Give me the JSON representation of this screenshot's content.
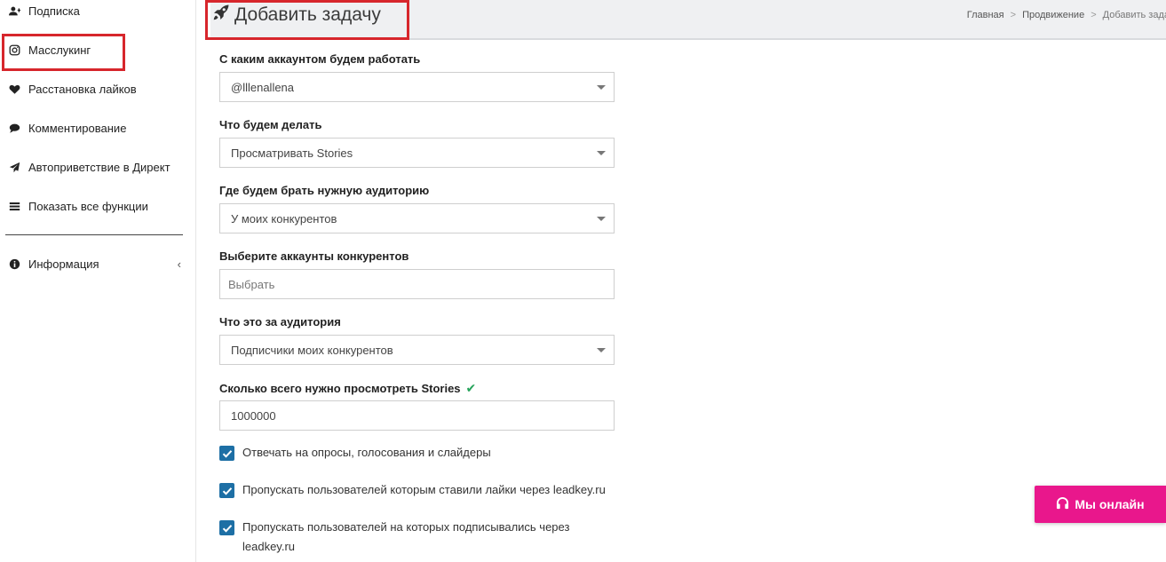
{
  "sidebar": {
    "items": [
      {
        "label": "Подписка",
        "icon": "user-plus-icon"
      },
      {
        "label": "Масслукинг",
        "icon": "instagram-icon"
      },
      {
        "label": "Расстановка лайков",
        "icon": "heart-icon"
      },
      {
        "label": "Комментирование",
        "icon": "comment-icon"
      },
      {
        "label": "Автоприветствие в Директ",
        "icon": "paper-plane-icon"
      },
      {
        "label": "Показать все функции",
        "icon": "list-icon"
      },
      {
        "label": "Информация",
        "icon": "info-icon"
      }
    ],
    "info_chevron": "‹"
  },
  "header": {
    "title": "Добавить задачу",
    "title_icon": "rocket-icon",
    "breadcrumb": [
      "Главная",
      "Продвижение",
      "Добавить зада"
    ]
  },
  "form": {
    "account": {
      "label": "С каким аккаунтом будем работать",
      "value": "@lllenallena"
    },
    "action": {
      "label": "Что будем делать",
      "value": "Просматривать Stories"
    },
    "audience_source": {
      "label": "Где будем брать нужную аудиторию",
      "value": "У моих конкурентов"
    },
    "competitors": {
      "label": "Выберите аккаунты конкурентов",
      "placeholder": "Выбрать"
    },
    "audience_type": {
      "label": "Что это за аудитория",
      "value": "Подписчики моих конкурентов"
    },
    "stories_count": {
      "label": "Сколько всего нужно просмотреть Stories",
      "value": "1000000",
      "valid_icon": "✔"
    },
    "checks": [
      {
        "label": "Отвечать на опросы, голосования и слайдеры",
        "checked": true
      },
      {
        "label": "Пропускать пользователей которым ставили лайки через leadkey.ru",
        "checked": true
      },
      {
        "label": "Пропускать пользователей на которых подписывались через leadkey.ru",
        "checked": true
      }
    ]
  },
  "online_button": {
    "label": "Мы онлайн",
    "icon": "headphones-icon"
  },
  "colors": {
    "accent_pink": "#e9178c",
    "highlight_red": "#d7262c",
    "checkbox_blue": "#1d6fa5",
    "valid_green": "#25a35a"
  }
}
